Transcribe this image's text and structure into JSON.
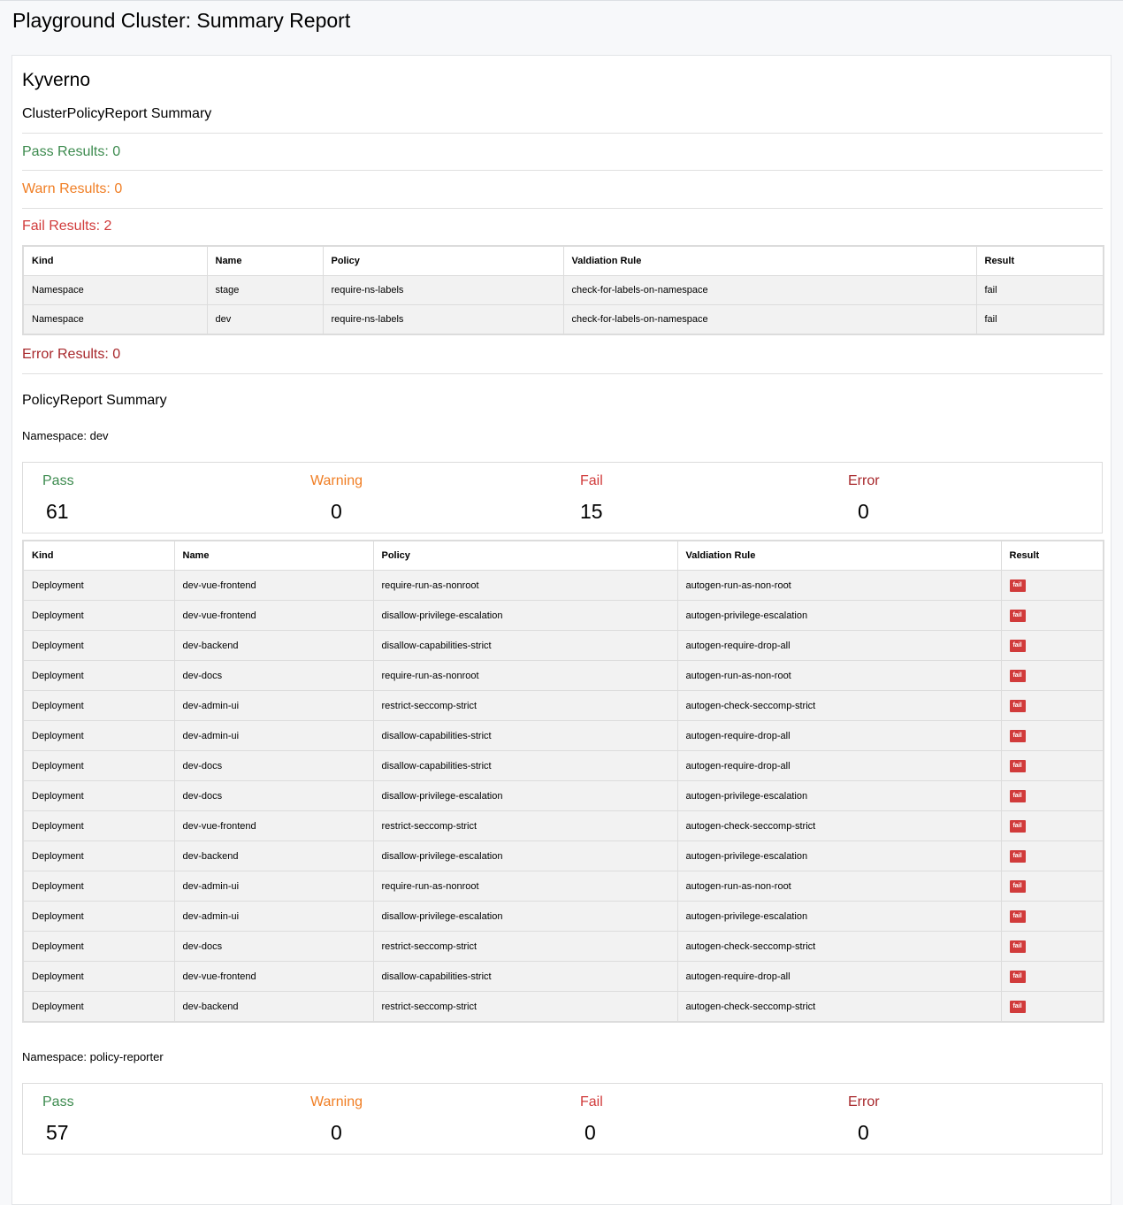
{
  "page": {
    "title": "Playground Cluster: Summary Report"
  },
  "engine": "Kyverno",
  "cluster_summary": {
    "heading": "ClusterPolicyReport Summary",
    "pass_label": "Pass Results: 0",
    "warn_label": "Warn Results: 0",
    "fail_label": "Fail Results: 2",
    "error_label": "Error Results: 0",
    "columns": [
      "Kind",
      "Name",
      "Policy",
      "Valdiation Rule",
      "Result"
    ],
    "rows": [
      {
        "kind": "Namespace",
        "name": "stage",
        "policy": "require-ns-labels",
        "rule": "check-for-labels-on-namespace",
        "result": "fail"
      },
      {
        "kind": "Namespace",
        "name": "dev",
        "policy": "require-ns-labels",
        "rule": "check-for-labels-on-namespace",
        "result": "fail"
      }
    ]
  },
  "policy_summary": {
    "heading": "PolicyReport Summary",
    "stat_labels": {
      "pass": "Pass",
      "warning": "Warning",
      "fail": "Fail",
      "error": "Error"
    },
    "namespaces": [
      {
        "label": "Namespace: dev",
        "pass": "61",
        "warning": "0",
        "fail": "15",
        "error": "0",
        "columns": [
          "Kind",
          "Name",
          "Policy",
          "Valdiation Rule",
          "Result"
        ],
        "rows": [
          {
            "kind": "Deployment",
            "name": "dev-vue-frontend",
            "policy": "require-run-as-nonroot",
            "rule": "autogen-run-as-non-root",
            "result": "fail"
          },
          {
            "kind": "Deployment",
            "name": "dev-vue-frontend",
            "policy": "disallow-privilege-escalation",
            "rule": "autogen-privilege-escalation",
            "result": "fail"
          },
          {
            "kind": "Deployment",
            "name": "dev-backend",
            "policy": "disallow-capabilities-strict",
            "rule": "autogen-require-drop-all",
            "result": "fail"
          },
          {
            "kind": "Deployment",
            "name": "dev-docs",
            "policy": "require-run-as-nonroot",
            "rule": "autogen-run-as-non-root",
            "result": "fail"
          },
          {
            "kind": "Deployment",
            "name": "dev-admin-ui",
            "policy": "restrict-seccomp-strict",
            "rule": "autogen-check-seccomp-strict",
            "result": "fail"
          },
          {
            "kind": "Deployment",
            "name": "dev-admin-ui",
            "policy": "disallow-capabilities-strict",
            "rule": "autogen-require-drop-all",
            "result": "fail"
          },
          {
            "kind": "Deployment",
            "name": "dev-docs",
            "policy": "disallow-capabilities-strict",
            "rule": "autogen-require-drop-all",
            "result": "fail"
          },
          {
            "kind": "Deployment",
            "name": "dev-docs",
            "policy": "disallow-privilege-escalation",
            "rule": "autogen-privilege-escalation",
            "result": "fail"
          },
          {
            "kind": "Deployment",
            "name": "dev-vue-frontend",
            "policy": "restrict-seccomp-strict",
            "rule": "autogen-check-seccomp-strict",
            "result": "fail"
          },
          {
            "kind": "Deployment",
            "name": "dev-backend",
            "policy": "disallow-privilege-escalation",
            "rule": "autogen-privilege-escalation",
            "result": "fail"
          },
          {
            "kind": "Deployment",
            "name": "dev-admin-ui",
            "policy": "require-run-as-nonroot",
            "rule": "autogen-run-as-non-root",
            "result": "fail"
          },
          {
            "kind": "Deployment",
            "name": "dev-admin-ui",
            "policy": "disallow-privilege-escalation",
            "rule": "autogen-privilege-escalation",
            "result": "fail"
          },
          {
            "kind": "Deployment",
            "name": "dev-docs",
            "policy": "restrict-seccomp-strict",
            "rule": "autogen-check-seccomp-strict",
            "result": "fail"
          },
          {
            "kind": "Deployment",
            "name": "dev-vue-frontend",
            "policy": "disallow-capabilities-strict",
            "rule": "autogen-require-drop-all",
            "result": "fail"
          },
          {
            "kind": "Deployment",
            "name": "dev-backend",
            "policy": "restrict-seccomp-strict",
            "rule": "autogen-check-seccomp-strict",
            "result": "fail"
          }
        ]
      },
      {
        "label": "Namespace: policy-reporter",
        "pass": "57",
        "warning": "0",
        "fail": "0",
        "error": "0"
      }
    ]
  },
  "colors": {
    "pass": "#3d8b4f",
    "warn": "#f07e24",
    "fail": "#d13b3b",
    "error": "#a8282c"
  }
}
